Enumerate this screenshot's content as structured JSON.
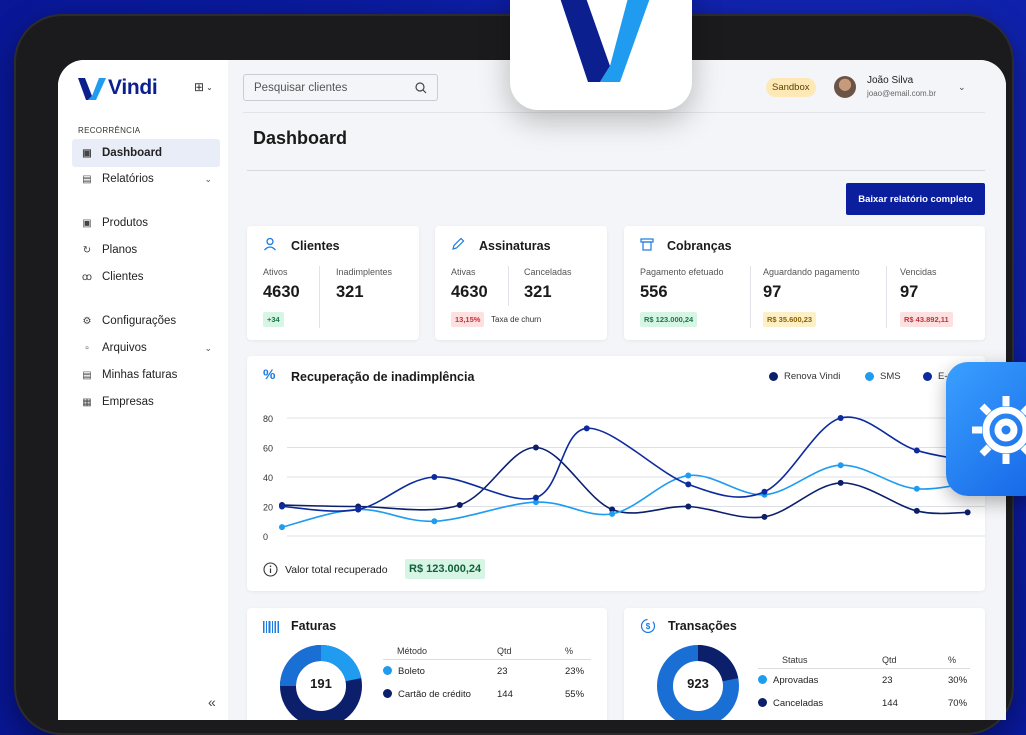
{
  "brand": {
    "name": "Vindi"
  },
  "sidebar": {
    "section": "RECORRÊNCIA",
    "items": [
      {
        "label": "Dashboard",
        "icon": "dashboard-icon",
        "active": true
      },
      {
        "label": "Relatórios",
        "icon": "report-icon",
        "chevron": true
      },
      {
        "label": "Produtos",
        "icon": "box-icon"
      },
      {
        "label": "Planos",
        "icon": "cycle-icon"
      },
      {
        "label": "Clientes",
        "icon": "users-icon"
      },
      {
        "label": "Configurações",
        "icon": "gear-icon"
      },
      {
        "label": "Arquivos",
        "icon": "file-icon",
        "chevron": true
      },
      {
        "label": "Minhas faturas",
        "icon": "invoice-icon"
      },
      {
        "label": "Empresas",
        "icon": "building-icon"
      }
    ],
    "collapse_glyph": "«"
  },
  "header": {
    "search_placeholder": "Pesquisar clientes",
    "env_badge": "Sandbox",
    "user_name": "João Silva",
    "user_email": "joao@email.com.br"
  },
  "page": {
    "title": "Dashboard",
    "download_label": "Baixar relatório completo"
  },
  "cards": {
    "clientes": {
      "title": "Clientes",
      "ativos_label": "Ativos",
      "ativos": "4630",
      "inad_label": "Inadimplentes",
      "inad": "321",
      "delta": "+34"
    },
    "assinaturas": {
      "title": "Assinaturas",
      "ativas_label": "Ativas",
      "ativas": "4630",
      "canc_label": "Canceladas",
      "canc": "321",
      "churn_pct": "13,15%",
      "churn_label": "Taxa de churn"
    },
    "cobrancas": {
      "title": "Cobranças",
      "pago_label": "Pagamento efetuado",
      "pago": "556",
      "pago_val": "R$ 123.000,24",
      "aguard_label": "Aguardando pagamento",
      "aguard": "97",
      "aguard_val": "R$ 35.600,23",
      "venc_label": "Vencidas",
      "venc": "97",
      "venc_val": "R$ 43.892,11"
    }
  },
  "recuperacao": {
    "title": "Recuperação de inadimplência",
    "total_label": "Valor total recuperado",
    "total_value": "R$ 123.000,24"
  },
  "chart_data": {
    "type": "line",
    "x": [
      1,
      2,
      3,
      4,
      5,
      6,
      7,
      8,
      9,
      10,
      11,
      12,
      13,
      14,
      15,
      16,
      17,
      18,
      19,
      20,
      21,
      22,
      23,
      24,
      25,
      26,
      27,
      28,
      29
    ],
    "ylim": [
      0,
      80
    ],
    "yticks": [
      0,
      20,
      40,
      60,
      80
    ],
    "grid": true,
    "legend_position": "top-right",
    "series": [
      {
        "name": "Renova Vindi",
        "color": "#0b1f6b",
        "points": [
          [
            1,
            21
          ],
          [
            4,
            20
          ],
          [
            8,
            21
          ],
          [
            11,
            60
          ],
          [
            14,
            18
          ],
          [
            17,
            20
          ],
          [
            20,
            13
          ],
          [
            23,
            36
          ],
          [
            26,
            17
          ],
          [
            28,
            16
          ]
        ]
      },
      {
        "name": "SMS",
        "color": "#1f9bf0",
        "points": [
          [
            1,
            6
          ],
          [
            4,
            18
          ],
          [
            7,
            10
          ],
          [
            11,
            23
          ],
          [
            14,
            15
          ],
          [
            17,
            41
          ],
          [
            20,
            28
          ],
          [
            23,
            48
          ],
          [
            26,
            32
          ],
          [
            29,
            40
          ]
        ]
      },
      {
        "name": "E-mail",
        "color": "#0d2a9e",
        "points": [
          [
            1,
            20
          ],
          [
            4,
            18
          ],
          [
            7,
            40
          ],
          [
            11,
            26
          ],
          [
            13,
            73
          ],
          [
            17,
            35
          ],
          [
            20,
            30
          ],
          [
            23,
            80
          ],
          [
            26,
            58
          ],
          [
            29,
            49
          ]
        ]
      }
    ]
  },
  "faturas": {
    "title": "Faturas",
    "total": "191",
    "headers": [
      "Método",
      "Qtd",
      "%"
    ],
    "rows": [
      {
        "label": "Boleto",
        "qtd": "23",
        "pct": "23%",
        "color": "#1f9bf0"
      },
      {
        "label": "Cartão de crédito",
        "qtd": "144",
        "pct": "55%",
        "color": "#0b1f6b"
      }
    ]
  },
  "transacoes": {
    "title": "Transações",
    "total": "923",
    "headers": [
      "Status",
      "Qtd",
      "%"
    ],
    "rows": [
      {
        "label": "Aprovadas",
        "qtd": "23",
        "pct": "30%",
        "color": "#1f9bf0"
      },
      {
        "label": "Canceladas",
        "qtd": "144",
        "pct": "70%",
        "color": "#0b1f6b"
      }
    ]
  }
}
